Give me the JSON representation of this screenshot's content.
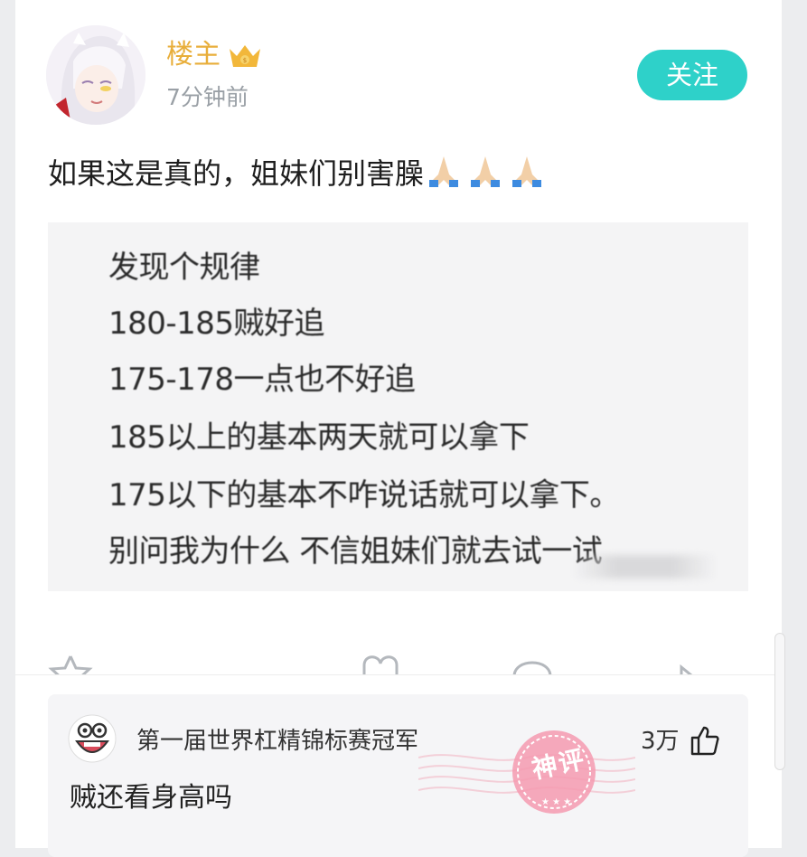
{
  "post": {
    "author": "楼主",
    "time": "7分钟前",
    "follow_label": "关注",
    "text": "如果这是真的，姐妹们别害臊",
    "image_lines": [
      "发现个规律",
      "180-185贼好追",
      "175-178一点也不好追",
      "185以上的基本两天就可以拿下",
      "175以下的基本不咋说话就可以拿下。",
      "别问我为什么 不信姐妹们就去试一试"
    ],
    "actions": {
      "like_count": "",
      "comment_count": "",
      "share_count": ""
    }
  },
  "hot_comment": {
    "user": "第一届世界杠精锦标赛冠军",
    "likes": "3万",
    "text": "贼还看身高吗",
    "stamp": "神评"
  },
  "colors": {
    "author": "#e8ae3a",
    "follow_button": "#2ed1c9",
    "stamp": "#f28aa0"
  }
}
